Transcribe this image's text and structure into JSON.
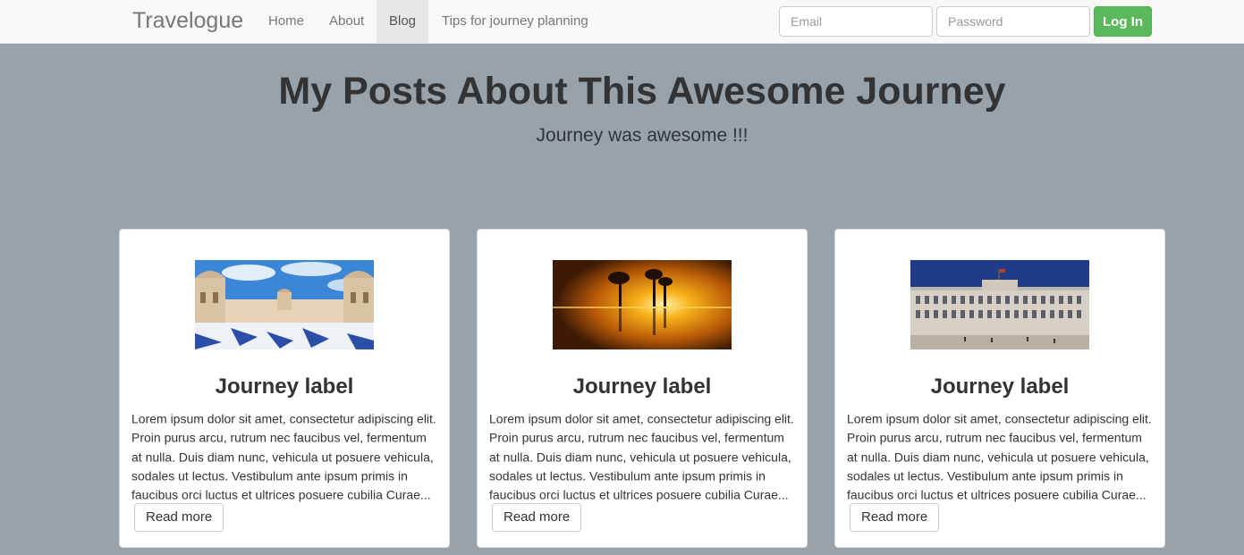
{
  "navbar": {
    "brand": "Travelogue",
    "items": [
      {
        "label": "Home",
        "active": false
      },
      {
        "label": "About",
        "active": false
      },
      {
        "label": "Blog",
        "active": true
      },
      {
        "label": "Tips for journey planning",
        "active": false
      }
    ],
    "email_placeholder": "Email",
    "password_placeholder": "Password",
    "login_label": "Log In"
  },
  "hero": {
    "title": "My Posts About This Awesome Journey",
    "subtitle": "Journey was awesome !!!"
  },
  "colors": {
    "background": "#98a2ab",
    "login_button": "#5cb85c"
  },
  "posts": [
    {
      "image": "palace-courtyard-photo",
      "title": "Journey label",
      "excerpt": "Lorem ipsum dolor sit amet, consectetur adipiscing elit. Proin purus arcu, rutrum nec faucibus vel, fermentum at nulla. Duis diam nunc, vehicula ut posuere vehicula, sodales ut lectus. Vestibulum ante ipsum primis in faucibus orci luctus et ultrices posuere cubilia Curae...",
      "button": "Read more"
    },
    {
      "image": "sunset-lake-trees-photo",
      "title": "Journey label",
      "excerpt": "Lorem ipsum dolor sit amet, consectetur adipiscing elit. Proin purus arcu, rutrum nec faucibus vel, fermentum at nulla. Duis diam nunc, vehicula ut posuere vehicula, sodales ut lectus. Vestibulum ante ipsum primis in faucibus orci luctus et ultrices posuere cubilia Curae...",
      "button": "Read more"
    },
    {
      "image": "royal-palace-photo",
      "title": "Journey label",
      "excerpt": "Lorem ipsum dolor sit amet, consectetur adipiscing elit. Proin purus arcu, rutrum nec faucibus vel, fermentum at nulla. Duis diam nunc, vehicula ut posuere vehicula, sodales ut lectus. Vestibulum ante ipsum primis in faucibus orci luctus et ultrices posuere cubilia Curae...",
      "button": "Read more"
    }
  ]
}
